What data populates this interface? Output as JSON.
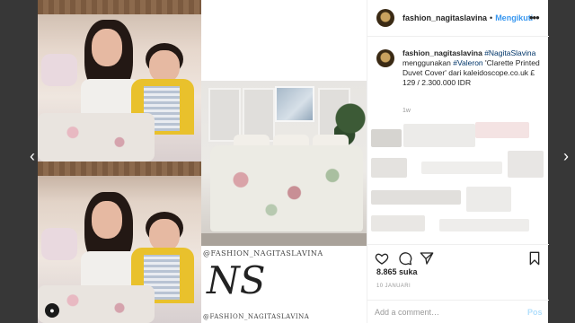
{
  "navigation": {
    "prev_icon": "chevron-left-icon",
    "next_icon": "chevron-right-icon",
    "prev_glyph": "‹",
    "next_glyph": "›"
  },
  "post": {
    "username": "fashion_nagitaslavina",
    "separator": "•",
    "follow_label": "Mengikuti",
    "more_glyph": "•••",
    "caption": {
      "username": "fashion_nagitaslavina",
      "hashtag_1": "#NagitaSlavina",
      "text_1": "menggunakan",
      "hashtag_2": "#Valeron",
      "text_2": "'Clarette Printed Duvet Cover' dari kaleidoscope.co.uk £ 129 / 2.300.000 IDR"
    },
    "age": "1w",
    "likes": "8.865 suka",
    "date": "10 JANUARI",
    "comment_placeholder": "Add a comment…",
    "post_label": "Pos"
  },
  "media": {
    "watermark_top": "@FASHION_NAGITASLAVINA",
    "watermark_mono": "NS",
    "watermark_bottom": "@FASHION_NAGITASLAVINA",
    "user_tag_icon": "user-tag-icon"
  },
  "colors": {
    "link_blue": "#3897f0",
    "hashtag_blue": "#003569",
    "post_disabled": "#b2dffc",
    "text": "#262626"
  }
}
